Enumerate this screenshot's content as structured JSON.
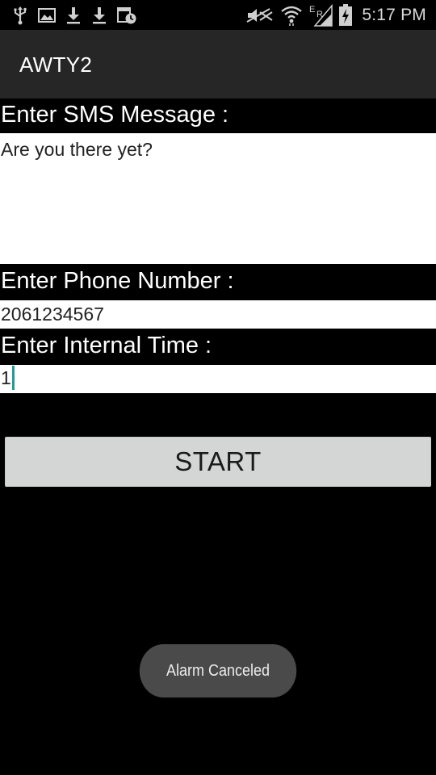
{
  "status_bar": {
    "time": "5:17 PM",
    "network_letters": "E R",
    "left_icons": [
      "usb-icon",
      "image-icon",
      "download-icon",
      "download-icon",
      "calendar-clock-icon"
    ],
    "right_icons": [
      "mute-icon",
      "wifi-icon",
      "signal-icon",
      "battery-charging-icon"
    ]
  },
  "action_bar": {
    "title": "AWTY2"
  },
  "form": {
    "message_label": "Enter SMS Message :",
    "message_value": "Are you there yet?",
    "phone_label": "Enter Phone Number :",
    "phone_value": "2061234567",
    "interval_label": "Enter Internal Time :",
    "interval_value": "1",
    "start_label": "START"
  },
  "toast": {
    "text": "Alarm Canceled"
  },
  "colors": {
    "background": "#000000",
    "action_bar": "#262626",
    "field_background": "#ffffff",
    "button_background": "#d4d6d5",
    "cursor": "#1e9e97",
    "toast_background": "#4a4a4a"
  }
}
